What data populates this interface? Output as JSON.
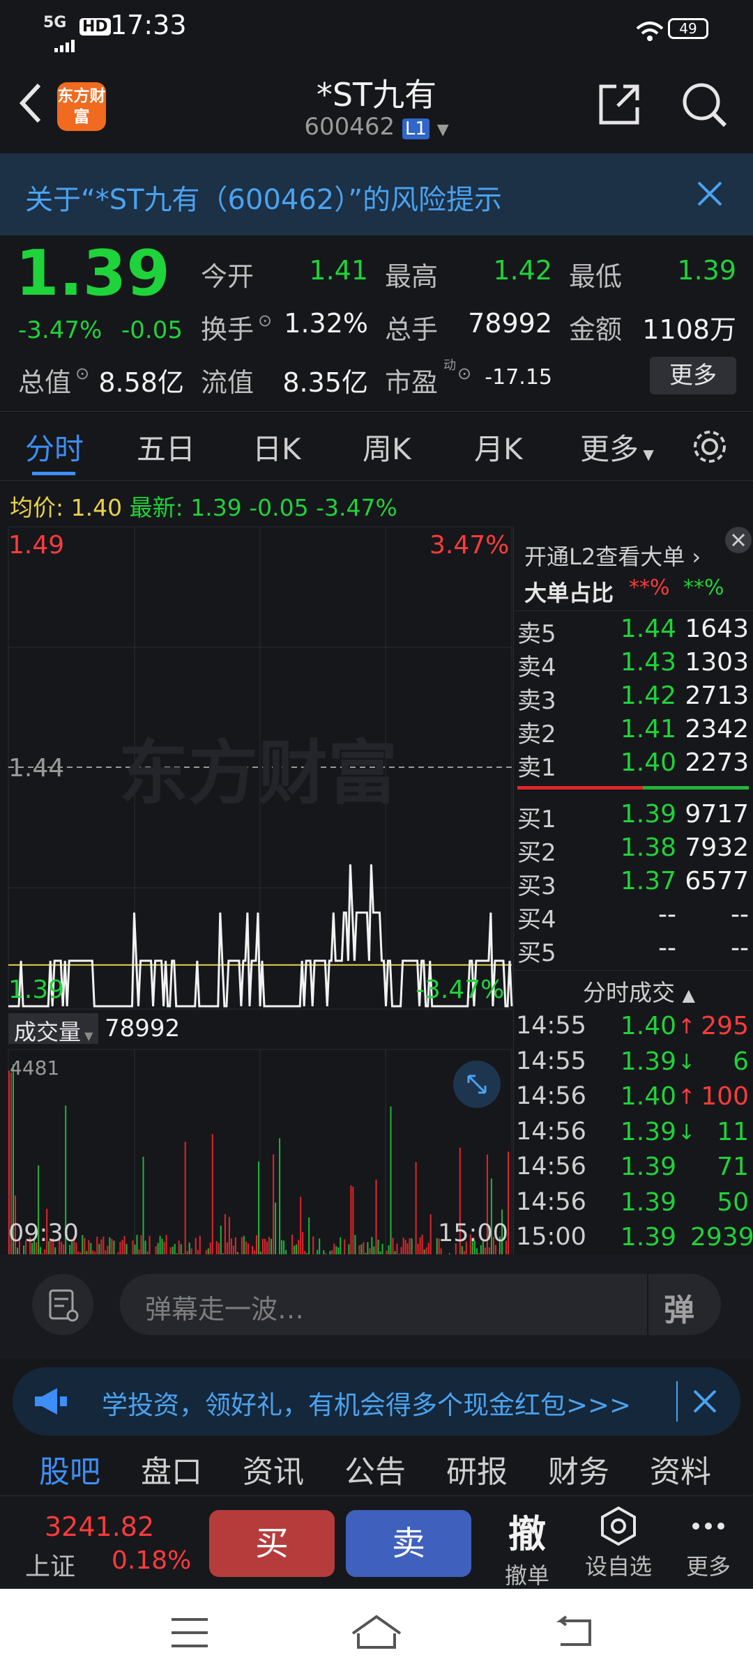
{
  "status": {
    "time": "17:33",
    "network": "5G",
    "hd": "HD",
    "battery": "49"
  },
  "nav": {
    "logo": "东方财富",
    "title": "*ST九有",
    "code": "600462",
    "level": "L1"
  },
  "risk": {
    "text": "关于“*ST九有（600462）”的风险提示"
  },
  "quote": {
    "price": "1.39",
    "pct": "-3.47%",
    "chg": "-0.05",
    "open_label": "今开",
    "open": "1.41",
    "high_label": "最高",
    "high": "1.42",
    "low_label": "最低",
    "low": "1.39",
    "turnover_label": "换手",
    "turnover": "1.32%",
    "vol_label": "总手",
    "vol": "78992",
    "amt_label": "金额",
    "amt": "1108万",
    "mcap_label": "总值",
    "mcap": "8.58亿",
    "float_label": "流值",
    "float": "8.35亿",
    "pe_label": "市盈",
    "pe_sup": "动",
    "pe": "-17.15",
    "more": "更多"
  },
  "tabs": [
    "分时",
    "五日",
    "日K",
    "周K",
    "月K",
    "更多"
  ],
  "summary": {
    "avg_label": "均价:",
    "avg": "1.40",
    "last_label": "最新:",
    "last": "1.39",
    "chg": "-0.05",
    "pct": "-3.47%"
  },
  "chart": {
    "top_price": "1.49",
    "top_pct": "3.47%",
    "mid_price": "1.44",
    "bot_price": "1.39",
    "bot_pct": "-3.47%",
    "watermark": "东方财富",
    "vol_label": "成交量",
    "vol_total": "78992",
    "vol_max": "4481",
    "t_start": "09:30",
    "t_end": "15:00"
  },
  "chart_data": {
    "type": "line",
    "x": [
      "09:30",
      "15:00"
    ],
    "ylim": [
      1.39,
      1.49
    ],
    "reference": 1.44,
    "series": [
      {
        "name": "最新",
        "values": [
          1.39,
          1.4,
          1.39,
          1.4,
          1.39,
          1.4,
          1.39,
          1.4,
          1.41,
          1.4,
          1.39,
          1.4,
          1.39
        ]
      },
      {
        "name": "均价",
        "values": [
          1.4,
          1.4,
          1.4,
          1.4,
          1.4,
          1.4,
          1.4,
          1.4,
          1.4,
          1.4,
          1.4,
          1.4,
          1.4
        ]
      }
    ]
  },
  "l2": {
    "promo": "开通L2查看大单",
    "big_label": "大单占比",
    "big_red": "**%",
    "big_green": "**%"
  },
  "asks": [
    {
      "l": "卖5",
      "p": "1.44",
      "v": "1643"
    },
    {
      "l": "卖4",
      "p": "1.43",
      "v": "1303"
    },
    {
      "l": "卖3",
      "p": "1.42",
      "v": "2713"
    },
    {
      "l": "卖2",
      "p": "1.41",
      "v": "2342"
    },
    {
      "l": "卖1",
      "p": "1.40",
      "v": "2273"
    }
  ],
  "bids": [
    {
      "l": "买1",
      "p": "1.39",
      "v": "9717"
    },
    {
      "l": "买2",
      "p": "1.38",
      "v": "7932"
    },
    {
      "l": "买3",
      "p": "1.37",
      "v": "6577"
    },
    {
      "l": "买4",
      "p": "--",
      "v": "--"
    },
    {
      "l": "买5",
      "p": "--",
      "v": "--"
    }
  ],
  "ticks_label": "分时成交",
  "ticks": [
    {
      "t": "14:55",
      "p": "1.40",
      "a": "↑",
      "v": "295",
      "c": "red"
    },
    {
      "t": "14:55",
      "p": "1.39",
      "a": "↓",
      "v": "6",
      "c": "green"
    },
    {
      "t": "14:56",
      "p": "1.40",
      "a": "↑",
      "v": "100",
      "c": "red"
    },
    {
      "t": "14:56",
      "p": "1.39",
      "a": "↓",
      "v": "11",
      "c": "green"
    },
    {
      "t": "14:56",
      "p": "1.39",
      "a": "",
      "v": "71",
      "c": "green"
    },
    {
      "t": "14:56",
      "p": "1.39",
      "a": "",
      "v": "50",
      "c": "green"
    },
    {
      "t": "15:00",
      "p": "1.39",
      "a": "",
      "v": "2939",
      "c": "green"
    }
  ],
  "danmaku": {
    "placeholder": "弹幕走一波…",
    "btn": "弹"
  },
  "promo": {
    "text": "学投资，领好礼，有机会得多个现金红包>>>"
  },
  "bottom_tabs": [
    "股吧",
    "盘口",
    "资讯",
    "公告",
    "研报",
    "财务",
    "资料"
  ],
  "index": {
    "value": "3241.82",
    "name": "上证",
    "pct": "0.18%"
  },
  "actions": {
    "buy": "买",
    "sell": "卖",
    "cancel_icon": "撤",
    "cancel": "撤单",
    "watch": "设自选",
    "more": "更多"
  }
}
